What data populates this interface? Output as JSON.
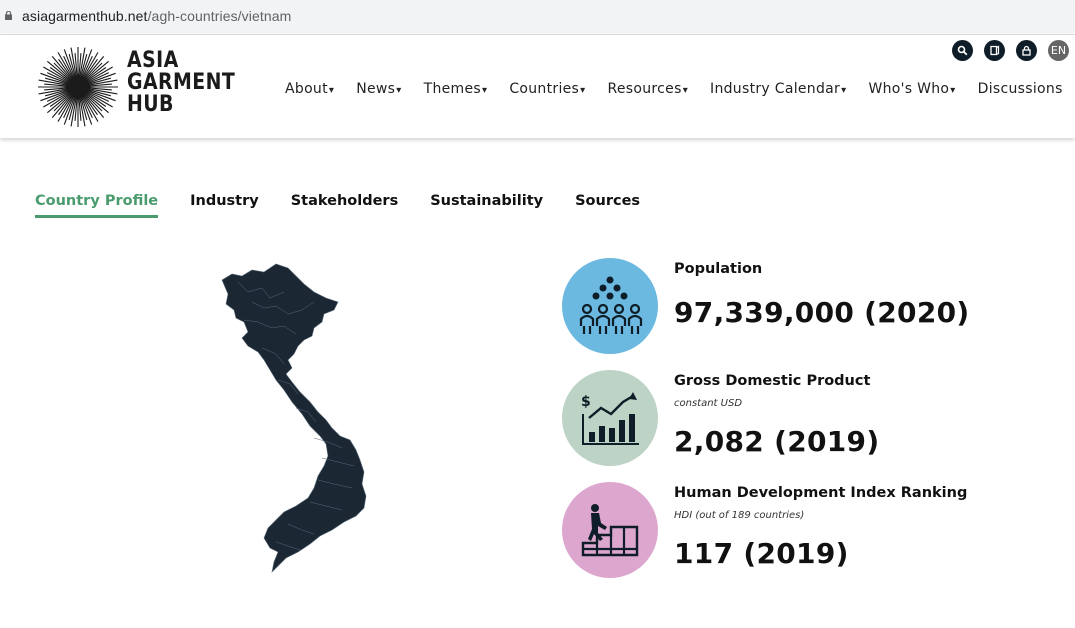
{
  "browser": {
    "url_host": "asiagarmenthub.net",
    "url_path": "/agh-countries/vietnam"
  },
  "header": {
    "logo_lines": [
      "ASIA",
      "GARMENT",
      "HUB"
    ],
    "util_icons": [
      {
        "name": "search-icon",
        "glyph": "⚲"
      },
      {
        "name": "book-icon",
        "glyph": "▯"
      },
      {
        "name": "lock-icon",
        "glyph": "🔒"
      },
      {
        "name": "language-icon",
        "label": "EN"
      }
    ],
    "nav": [
      {
        "label": "About",
        "caret": "▾"
      },
      {
        "label": "News",
        "caret": "▾"
      },
      {
        "label": "Themes",
        "caret": "▾"
      },
      {
        "label": "Countries",
        "caret": "▾"
      },
      {
        "label": "Resources",
        "caret": "▾"
      },
      {
        "label": "Industry Calendar",
        "caret": "▾"
      },
      {
        "label": "Who's Who",
        "caret": "▾"
      },
      {
        "label": "Discussions",
        "caret": ""
      }
    ]
  },
  "tabs": [
    {
      "label": "Country Profile",
      "active": true
    },
    {
      "label": "Industry",
      "active": false
    },
    {
      "label": "Stakeholders",
      "active": false
    },
    {
      "label": "Sustainability",
      "active": false
    },
    {
      "label": "Sources",
      "active": false
    }
  ],
  "stats": {
    "population": {
      "label": "Population",
      "value": "97,339,000 (2020)",
      "color": "#6bb8e0",
      "icon": "population-icon"
    },
    "gdp": {
      "label": "Gross Domestic Product",
      "sub": "constant USD",
      "value": "2,082 (2019)",
      "color": "#bdd3c6",
      "icon": "gdp-growth-icon"
    },
    "hdi": {
      "label": "Human Development Index Ranking",
      "sub": "HDI (out of 189 countries)",
      "value": "117 (2019)",
      "color": "#dca6cf",
      "icon": "climbing-stairs-icon"
    }
  },
  "colors": {
    "accent": "#4a9c6e",
    "map_fill": "#1b2733",
    "dark_icon": "#0f1d28"
  }
}
